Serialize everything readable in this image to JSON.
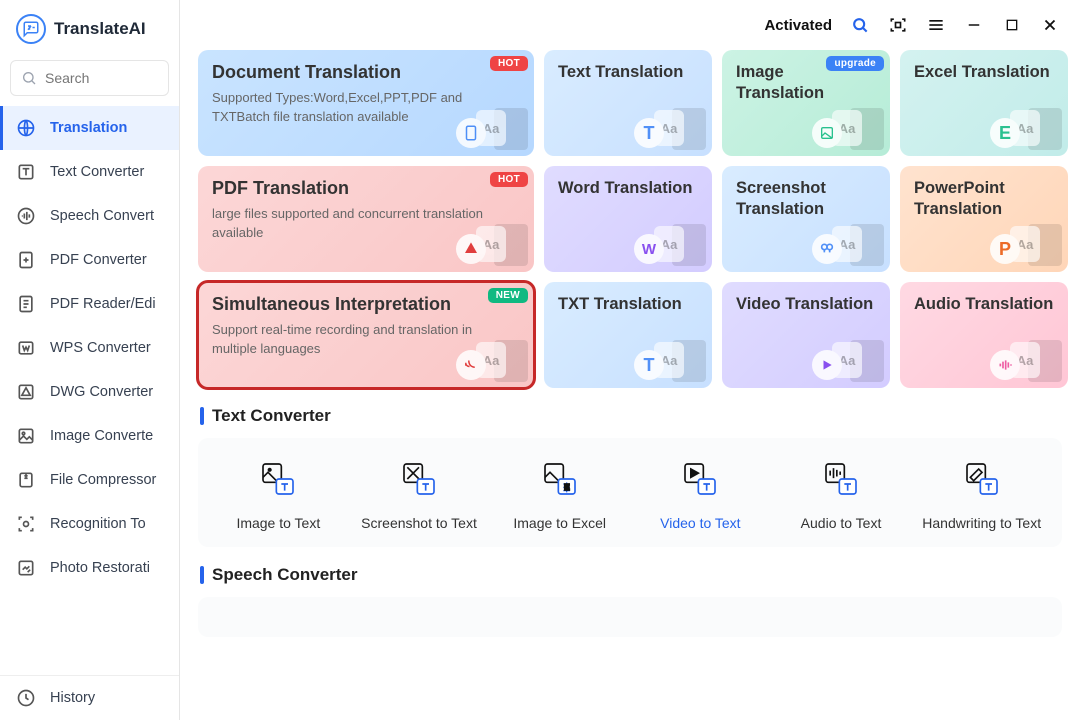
{
  "app": {
    "name": "TranslateAI"
  },
  "header": {
    "status": "Activated"
  },
  "search": {
    "placeholder": "Search"
  },
  "sidebar": {
    "items": [
      {
        "label": "Translation",
        "icon": "globe-icon",
        "active": true
      },
      {
        "label": "Text Converter",
        "icon": "text-icon"
      },
      {
        "label": "Speech Convert",
        "icon": "wave-icon"
      },
      {
        "label": "PDF Converter",
        "icon": "pdf-icon"
      },
      {
        "label": "PDF Reader/Edi",
        "icon": "pdf-read-icon"
      },
      {
        "label": "WPS Converter",
        "icon": "wps-icon"
      },
      {
        "label": "DWG Converter",
        "icon": "dwg-icon"
      },
      {
        "label": "Image Converte",
        "icon": "image-icon"
      },
      {
        "label": "File Compressor",
        "icon": "compress-icon"
      },
      {
        "label": "Recognition To",
        "icon": "scan-icon"
      },
      {
        "label": "Photo Restorati",
        "icon": "restore-icon"
      }
    ],
    "history": "History"
  },
  "cards": {
    "row1": {
      "big": {
        "title": "Document Translation",
        "desc": "Supported Types:Word,Excel,PPT,PDF and TXTBatch file translation available",
        "badge": "HOT"
      },
      "s1": {
        "title": "Text Translation"
      },
      "s2": {
        "title": "Image Translation",
        "badge": "upgrade"
      },
      "s3": {
        "title": "Excel Translation"
      }
    },
    "row2": {
      "big": {
        "title": "PDF Translation",
        "desc": "large files supported and concurrent translation available",
        "badge": "HOT"
      },
      "s1": {
        "title": "Word Translation"
      },
      "s2": {
        "title": "Screenshot Translation"
      },
      "s3": {
        "title": "PowerPoint Translation"
      }
    },
    "row3": {
      "big": {
        "title": "Simultaneous Interpretation",
        "desc": "Support real-time recording and translation in multiple languages",
        "badge": "NEW"
      },
      "s1": {
        "title": "TXT Translation"
      },
      "s2": {
        "title": "Video Translation"
      },
      "s3": {
        "title": "Audio Translation"
      }
    }
  },
  "sections": {
    "text_converter": "Text Converter",
    "speech_converter": "Speech Converter"
  },
  "tools": [
    {
      "label": "Image to Text"
    },
    {
      "label": "Screenshot to Text"
    },
    {
      "label": "Image to Excel"
    },
    {
      "label": "Video to Text",
      "highlight": true
    },
    {
      "label": "Audio to Text"
    },
    {
      "label": "Handwriting to Text"
    }
  ]
}
